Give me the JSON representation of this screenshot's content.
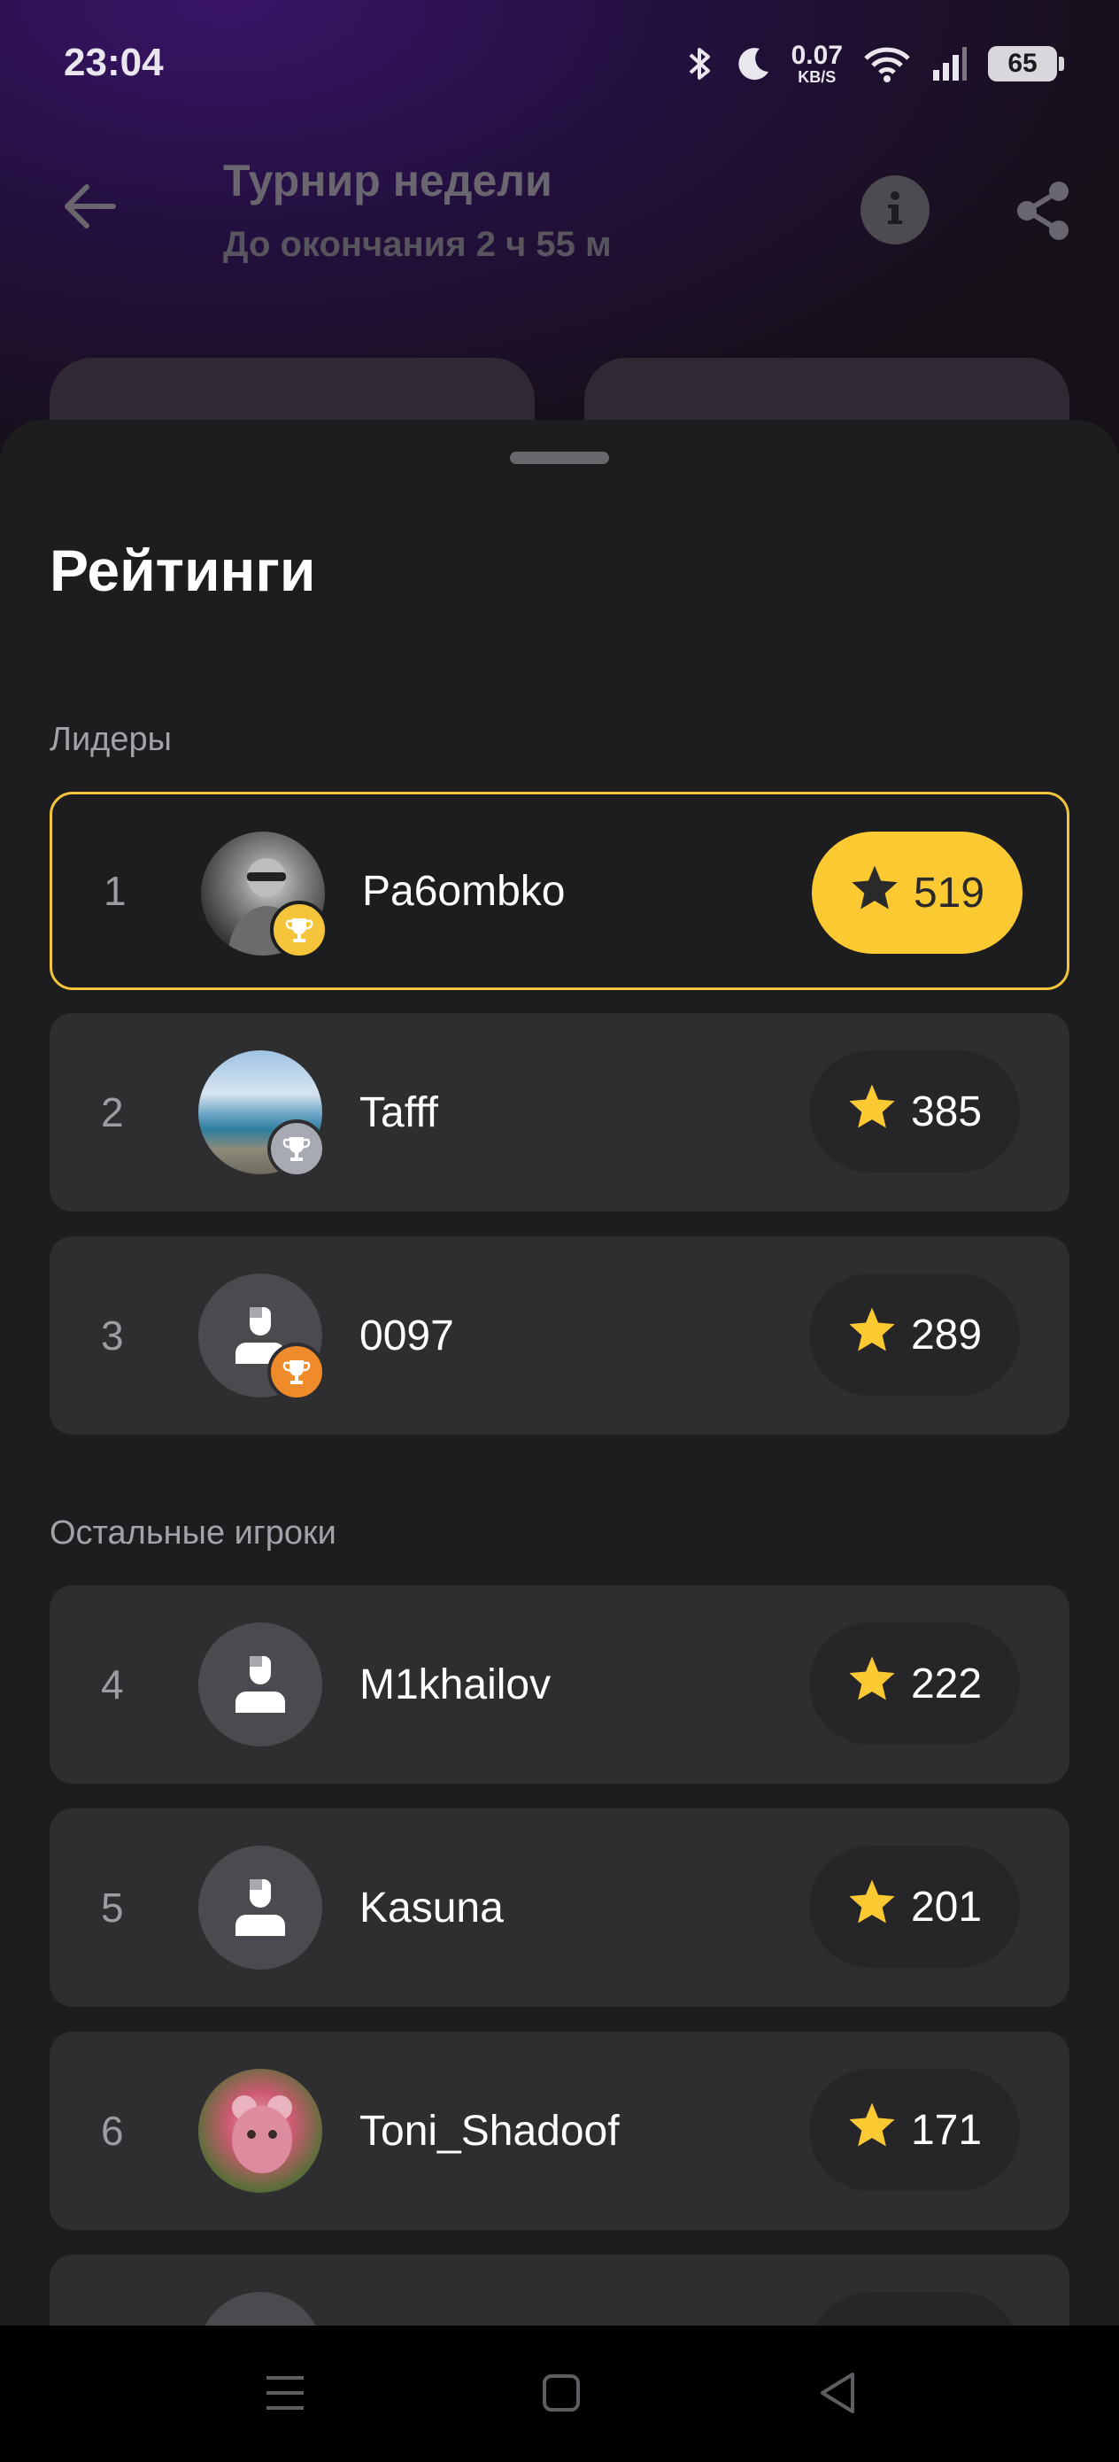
{
  "status_bar": {
    "time": "23:04",
    "net_speed_value": "0.07",
    "net_speed_unit": "KB/S",
    "battery": "65"
  },
  "header": {
    "title": "Турнир недели",
    "subtitle": "До окончания 2 ч 55 м"
  },
  "sheet": {
    "title": "Рейтинги",
    "leaders_label": "Лидеры",
    "others_label": "Остальные игроки"
  },
  "leaders": [
    {
      "rank": "1",
      "name": "Pa6ombko",
      "score": "519",
      "trophy": "gold"
    },
    {
      "rank": "2",
      "name": "Tafff",
      "score": "385",
      "trophy": "silver"
    },
    {
      "rank": "3",
      "name": "0097",
      "score": "289",
      "trophy": "bronze"
    }
  ],
  "others": [
    {
      "rank": "4",
      "name": "M1khailov",
      "score": "222"
    },
    {
      "rank": "5",
      "name": "Kasuna",
      "score": "201"
    },
    {
      "rank": "6",
      "name": "Toni_Shadoof",
      "score": "171"
    }
  ],
  "colors": {
    "accent": "#fbc932",
    "gold": "#f4c43a",
    "silver": "#a7aab2",
    "bronze": "#ef8b2a",
    "star": "#fbc932"
  },
  "icons": {
    "back": "arrow-left-icon",
    "info": "info-icon",
    "share": "share-icon",
    "star": "star-icon",
    "trophy": "trophy-icon",
    "user": "user-placeholder-icon"
  }
}
